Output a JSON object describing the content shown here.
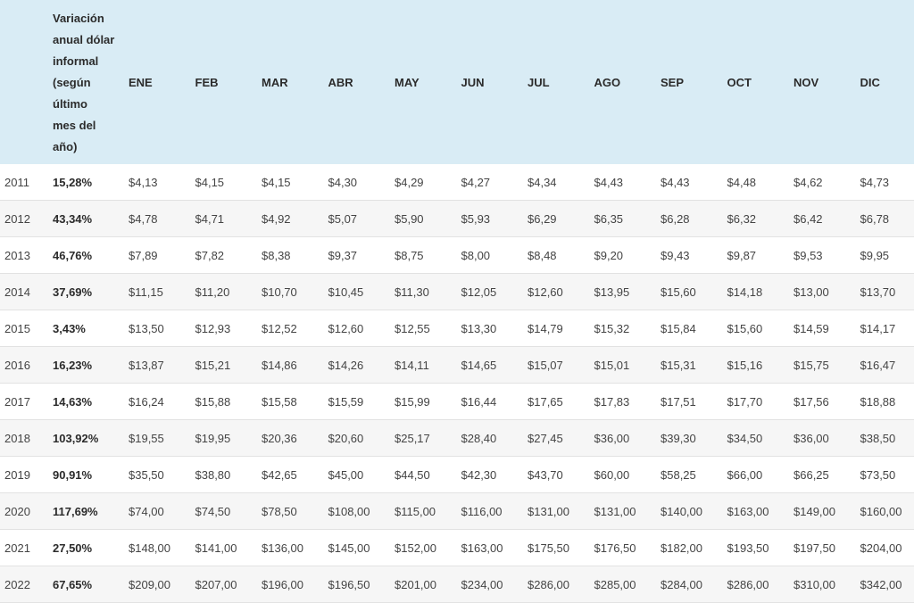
{
  "header": {
    "variation_label": "Variación anual dólar informal (según último mes del año)",
    "variation_lines": [
      "Variación",
      "anual dólar",
      "informal",
      "(según",
      "último",
      "mes del",
      "año)"
    ],
    "months": [
      "ENE",
      "FEB",
      "MAR",
      "ABR",
      "MAY",
      "JUN",
      "JUL",
      "AGO",
      "SEP",
      "OCT",
      "NOV",
      "DIC"
    ]
  },
  "rows": [
    {
      "year": "2011",
      "variation": "15,28%",
      "values": [
        "$4,13",
        "$4,15",
        "$4,15",
        "$4,30",
        "$4,29",
        "$4,27",
        "$4,34",
        "$4,43",
        "$4,43",
        "$4,48",
        "$4,62",
        "$4,73"
      ]
    },
    {
      "year": "2012",
      "variation": "43,34%",
      "values": [
        "$4,78",
        "$4,71",
        "$4,92",
        "$5,07",
        "$5,90",
        "$5,93",
        "$6,29",
        "$6,35",
        "$6,28",
        "$6,32",
        "$6,42",
        "$6,78"
      ]
    },
    {
      "year": "2013",
      "variation": "46,76%",
      "values": [
        "$7,89",
        "$7,82",
        "$8,38",
        "$9,37",
        "$8,75",
        "$8,00",
        "$8,48",
        "$9,20",
        "$9,43",
        "$9,87",
        "$9,53",
        "$9,95"
      ]
    },
    {
      "year": "2014",
      "variation": "37,69%",
      "values": [
        "$11,15",
        "$11,20",
        "$10,70",
        "$10,45",
        "$11,30",
        "$12,05",
        "$12,60",
        "$13,95",
        "$15,60",
        "$14,18",
        "$13,00",
        "$13,70"
      ]
    },
    {
      "year": "2015",
      "variation": "3,43%",
      "values": [
        "$13,50",
        "$12,93",
        "$12,52",
        "$12,60",
        "$12,55",
        "$13,30",
        "$14,79",
        "$15,32",
        "$15,84",
        "$15,60",
        "$14,59",
        "$14,17"
      ]
    },
    {
      "year": "2016",
      "variation": "16,23%",
      "values": [
        "$13,87",
        "$15,21",
        "$14,86",
        "$14,26",
        "$14,11",
        "$14,65",
        "$15,07",
        "$15,01",
        "$15,31",
        "$15,16",
        "$15,75",
        "$16,47"
      ]
    },
    {
      "year": "2017",
      "variation": "14,63%",
      "values": [
        "$16,24",
        "$15,88",
        "$15,58",
        "$15,59",
        "$15,99",
        "$16,44",
        "$17,65",
        "$17,83",
        "$17,51",
        "$17,70",
        "$17,56",
        "$18,88"
      ]
    },
    {
      "year": "2018",
      "variation": "103,92%",
      "values": [
        "$19,55",
        "$19,95",
        "$20,36",
        "$20,60",
        "$25,17",
        "$28,40",
        "$27,45",
        "$36,00",
        "$39,30",
        "$34,50",
        "$36,00",
        "$38,50"
      ]
    },
    {
      "year": "2019",
      "variation": "90,91%",
      "values": [
        "$35,50",
        "$38,80",
        "$42,65",
        "$45,00",
        "$44,50",
        "$42,30",
        "$43,70",
        "$60,00",
        "$58,25",
        "$66,00",
        "$66,25",
        "$73,50"
      ]
    },
    {
      "year": "2020",
      "variation": "117,69%",
      "values": [
        "$74,00",
        "$74,50",
        "$78,50",
        "$108,00",
        "$115,00",
        "$116,00",
        "$131,00",
        "$131,00",
        "$140,00",
        "$163,00",
        "$149,00",
        "$160,00"
      ]
    },
    {
      "year": "2021",
      "variation": "27,50%",
      "values": [
        "$148,00",
        "$141,00",
        "$136,00",
        "$145,00",
        "$152,00",
        "$163,00",
        "$175,50",
        "$176,50",
        "$182,00",
        "$193,50",
        "$197,50",
        "$204,00"
      ]
    },
    {
      "year": "2022",
      "variation": "67,65%",
      "values": [
        "$209,00",
        "$207,00",
        "$196,00",
        "$196,50",
        "$201,00",
        "$234,00",
        "$286,00",
        "$285,00",
        "$284,00",
        "$286,00",
        "$310,00",
        "$342,00"
      ]
    }
  ]
}
